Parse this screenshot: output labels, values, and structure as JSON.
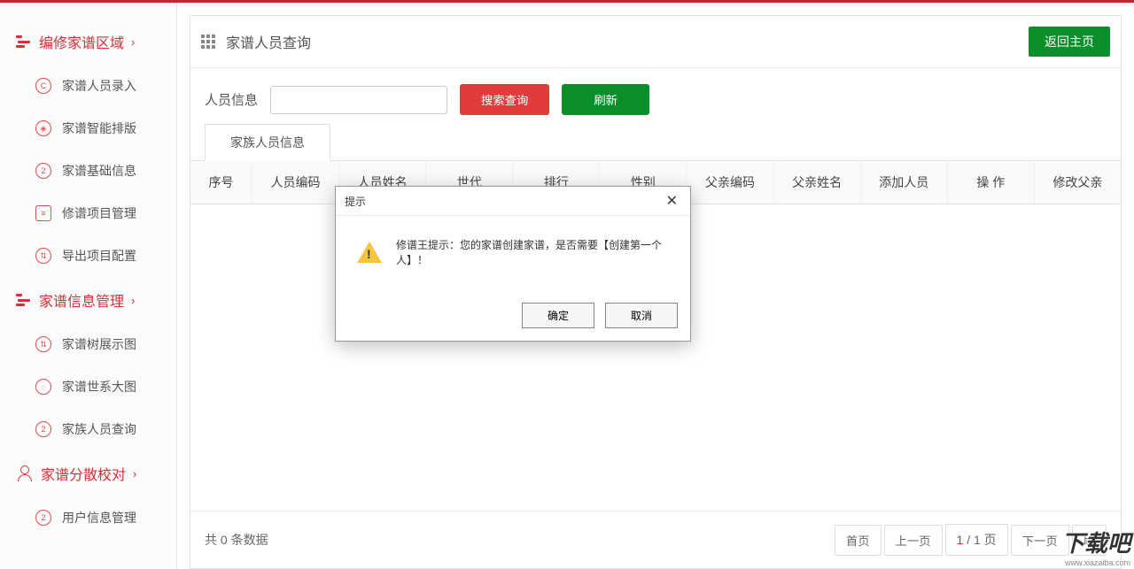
{
  "sidebar": {
    "section1": {
      "label": "编修家谱区域"
    },
    "items1": [
      {
        "label": "家谱人员录入"
      },
      {
        "label": "家谱智能排版"
      },
      {
        "label": "家谱基础信息"
      },
      {
        "label": "修谱项目管理"
      },
      {
        "label": "导出项目配置"
      }
    ],
    "section2": {
      "label": "家谱信息管理"
    },
    "items2": [
      {
        "label": "家谱树展示图"
      },
      {
        "label": "家谱世系大图"
      },
      {
        "label": "家族人员查询"
      }
    ],
    "section3": {
      "label": "家谱分散校对"
    },
    "items3": [
      {
        "label": "用户信息管理"
      }
    ]
  },
  "header": {
    "title": "家谱人员查询",
    "back_button": "返回主页"
  },
  "search": {
    "label": "人员信息",
    "input_value": "",
    "search_button": "搜索查询",
    "refresh_button": "刷新"
  },
  "tab": {
    "label": "家族人员信息"
  },
  "table": {
    "columns": [
      "序号",
      "人员编码",
      "人员姓名",
      "世代",
      "排行",
      "性别",
      "父亲编码",
      "父亲姓名",
      "添加人员",
      "操  作",
      "修改父亲"
    ]
  },
  "modal": {
    "title": "提示",
    "message": "修谱王提示：您的家谱创建家谱，是否需要【创建第一个人】！",
    "ok": "确定",
    "cancel": "取消"
  },
  "footer": {
    "prefix": "共 ",
    "count": "0",
    "suffix": " 条数据",
    "first": "首页",
    "prev": "上一页",
    "cur": "1",
    "sep": " / ",
    "total": "1 页",
    "next": "下一页",
    "last": "尾"
  },
  "watermark": {
    "text": "下载吧",
    "url": "www.xiazaiba.com"
  }
}
